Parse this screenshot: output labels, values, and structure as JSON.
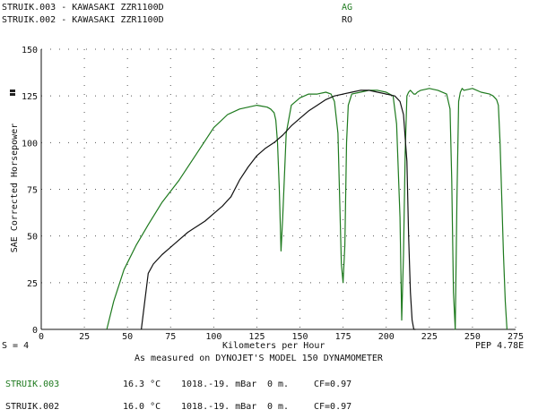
{
  "header": {
    "run1": {
      "name": "STRUIK.003 - KAWASAKI ZZR1100D",
      "code": "AG",
      "color": "#1e7a1e"
    },
    "run2": {
      "name": "STRUIK.002 - KAWASAKI ZZR1100D",
      "code": "RO",
      "color": "#111111"
    }
  },
  "footer": {
    "s_value": "S = 4",
    "pep": "PEP 4.78E",
    "caption": "As measured on DYNOJET'S MODEL 150 DYNAMOMETER"
  },
  "weather": [
    {
      "run": "STRUIK.003",
      "temp": "16.3 °C",
      "pressure": "1018.-19. mBar",
      "alt": "0 m.",
      "cf": "CF=0.97",
      "color": "#1e7a1e"
    },
    {
      "run": "STRUIK.002",
      "temp": "16.0 °C",
      "pressure": "1018.-19. mBar",
      "alt": "0 m.",
      "cf": "CF=0.97",
      "color": "#111111"
    }
  ],
  "chart_data": {
    "type": "line",
    "title": "",
    "xlabel": "Kilometers per Hour",
    "ylabel": "SAE Corrected Horsepower",
    "xlim": [
      0,
      275
    ],
    "ylim": [
      0,
      150
    ],
    "xticks": [
      "0",
      "25",
      "50",
      "75",
      "100",
      "125",
      "150",
      "175",
      "200",
      "225",
      "250",
      "275"
    ],
    "yticks": [
      "0",
      "25",
      "50",
      "75",
      "100",
      "125",
      "150"
    ],
    "grid": "dotted",
    "series": [
      {
        "name": "STRUIK.003",
        "color": "#1e7a1e",
        "x": [
          38,
          42,
          48,
          55,
          62,
          70,
          80,
          90,
          100,
          108,
          115,
          120,
          125,
          128,
          131,
          133,
          135,
          136,
          137,
          138,
          139,
          140,
          142,
          145,
          150,
          155,
          160,
          165,
          168,
          170,
          172,
          173,
          174,
          175,
          176,
          177,
          178,
          180,
          185,
          190,
          195,
          200,
          204,
          206,
          208,
          209,
          210,
          211,
          212,
          213,
          214,
          215,
          216,
          217,
          218,
          220,
          225,
          230,
          235,
          237,
          238,
          239,
          240,
          241,
          242,
          243,
          244,
          245,
          250,
          255,
          260,
          262,
          264,
          265,
          266,
          267,
          268,
          269,
          270
        ],
        "y": [
          0,
          15,
          32,
          45,
          56,
          68,
          80,
          94,
          108,
          115,
          118,
          119,
          120,
          119.5,
          119,
          118,
          116,
          112,
          100,
          75,
          42,
          60,
          105,
          120,
          124,
          126,
          126,
          127,
          126,
          122,
          105,
          70,
          35,
          25,
          45,
          100,
          120,
          126,
          127,
          128,
          128,
          127,
          125,
          110,
          60,
          5,
          40,
          95,
          125,
          127,
          128,
          127,
          126,
          126,
          127,
          128,
          129,
          128,
          126,
          118,
          80,
          20,
          0,
          70,
          122,
          127,
          129,
          128,
          129,
          127,
          126,
          125,
          123,
          120,
          100,
          70,
          40,
          15,
          0
        ]
      },
      {
        "name": "STRUIK.002",
        "color": "#111111",
        "x": [
          58,
          62,
          65,
          70,
          75,
          80,
          85,
          90,
          95,
          100,
          105,
          110,
          115,
          120,
          125,
          130,
          135,
          140,
          145,
          150,
          155,
          160,
          165,
          170,
          175,
          180,
          185,
          190,
          195,
          200,
          205,
          208,
          210,
          212,
          213,
          214,
          215,
          216,
          217
        ],
        "y": [
          0,
          30,
          35,
          40,
          44,
          48,
          52,
          55,
          58,
          62,
          66,
          71,
          80,
          87,
          93,
          97,
          100,
          104,
          109,
          113,
          117,
          120,
          123,
          125,
          126,
          127,
          128,
          128,
          127,
          126,
          125,
          122,
          115,
          90,
          50,
          20,
          5,
          0,
          0
        ]
      }
    ]
  }
}
